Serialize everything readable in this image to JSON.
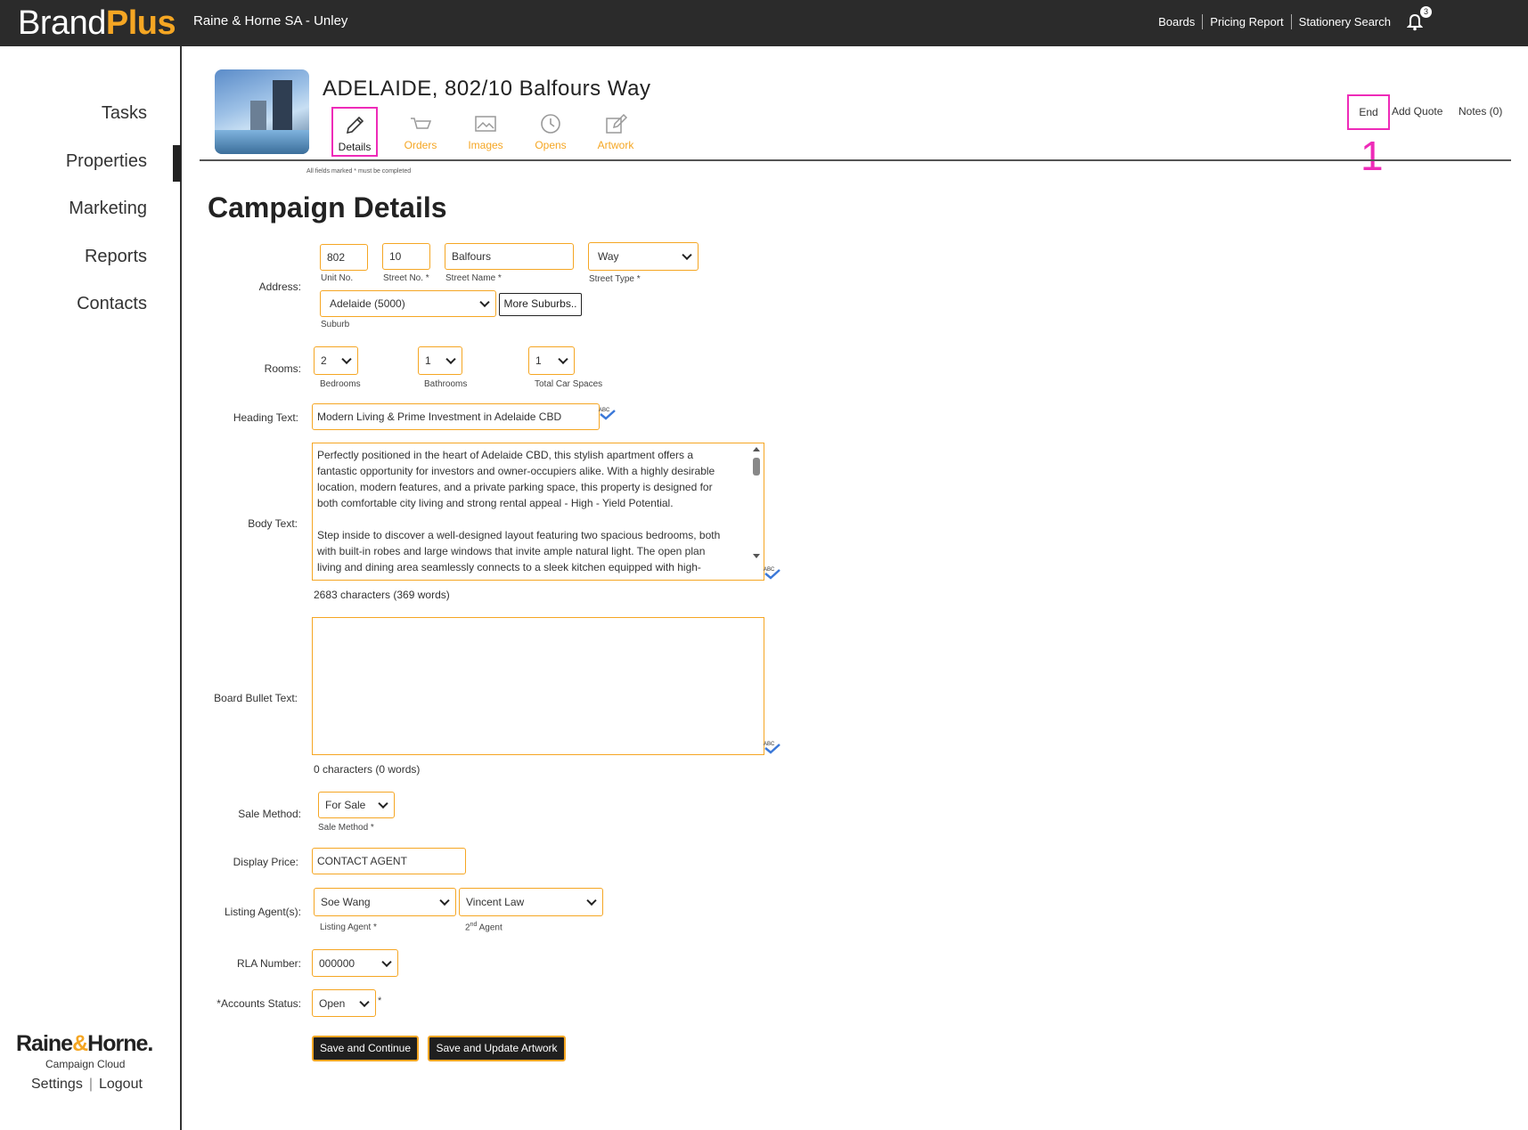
{
  "header": {
    "brand_main": "Brand",
    "brand_accent": "Plus",
    "office": "Raine & Horne SA - Unley",
    "links": [
      "Boards",
      "Pricing Report",
      "Stationery Search"
    ],
    "notifications_count": "3"
  },
  "sidebar": {
    "items": [
      {
        "label": "Tasks"
      },
      {
        "label": "Properties"
      },
      {
        "label": "Marketing"
      },
      {
        "label": "Reports"
      },
      {
        "label": "Contacts"
      }
    ],
    "active_item": "Properties",
    "logo_main": "Raine",
    "logo_amp": "&",
    "logo_end": "Horne.",
    "logo_sub": "Campaign Cloud",
    "settings": "Settings",
    "separator": "|",
    "logout": "Logout"
  },
  "property": {
    "title": "ADELAIDE, 802/10 Balfours Way",
    "tabs": [
      {
        "label": "Details",
        "icon": "pencil-icon"
      },
      {
        "label": "Orders",
        "icon": "cart-icon"
      },
      {
        "label": "Images",
        "icon": "image-icon"
      },
      {
        "label": "Opens",
        "icon": "clock-icon"
      },
      {
        "label": "Artwork",
        "icon": "edit-document-icon"
      }
    ],
    "active_tab": "Details",
    "hint": "All fields marked * must be completed",
    "actions": {
      "end": "End",
      "add_quote": "Add Quote",
      "notes": "Notes (0)"
    },
    "marker": "1"
  },
  "form": {
    "title": "Campaign Details",
    "address": {
      "label": "Address:",
      "unit_no": "802",
      "unit_no_sub": "Unit No.",
      "street_no": "10",
      "street_no_sub": "Street No. *",
      "street_name": "Balfours",
      "street_name_sub": "Street Name *",
      "street_type": "Way",
      "street_type_sub": "Street Type *",
      "suburb": "Adelaide (5000)",
      "suburb_sub": "Suburb",
      "more_suburbs": "More Suburbs.."
    },
    "rooms": {
      "label": "Rooms:",
      "bedrooms": "2",
      "bedrooms_sub": "Bedrooms",
      "bathrooms": "1",
      "bathrooms_sub": "Bathrooms",
      "car_spaces": "1",
      "car_spaces_sub": "Total Car Spaces"
    },
    "heading": {
      "label": "Heading Text:",
      "value": "Modern Living & Prime Investment in Adelaide CBD"
    },
    "body": {
      "label": "Body Text:",
      "lines": [
        "Perfectly positioned in the heart of Adelaide CBD, this stylish apartment offers a",
        "fantastic opportunity for investors and owner-occupiers alike. With a highly desirable",
        "location, modern features, and a private parking space, this property is designed for",
        "both comfortable city living and strong rental appeal - High - Yield Potential.",
        "",
        "Step inside to discover a well-designed layout featuring two spacious bedrooms, both",
        "with built-in robes and large windows that invite ample natural light. The open plan",
        "living and dining area seamlessly connects to a sleek kitchen equipped with high-"
      ],
      "counter": "2683 characters (369 words)"
    },
    "board_bullet": {
      "label": "Board Bullet Text:",
      "value": "",
      "counter": "0 characters (0 words)"
    },
    "sale_method": {
      "label": "Sale Method:",
      "value": "For Sale",
      "sub": "Sale Method *"
    },
    "display_price": {
      "label": "Display Price:",
      "value": "CONTACT AGENT"
    },
    "agents": {
      "label": "Listing Agent(s):",
      "agent1": "Soe Wang",
      "agent1_sub": "Listing Agent *",
      "agent2": "Vincent Law",
      "agent2_sub_pre": "2",
      "agent2_sub_sup": "nd",
      "agent2_sub_post": " Agent"
    },
    "rla": {
      "label": "RLA Number:",
      "value": "000000"
    },
    "accounts": {
      "label": "*Accounts Status:",
      "value": "Open",
      "required": "*"
    },
    "buttons": {
      "save_continue": "Save and Continue",
      "save_update": "Save and Update Artwork"
    }
  },
  "colors": {
    "accent": "#f5a623",
    "highlight": "#ee2bb8",
    "topbar": "#2b2b2b"
  }
}
